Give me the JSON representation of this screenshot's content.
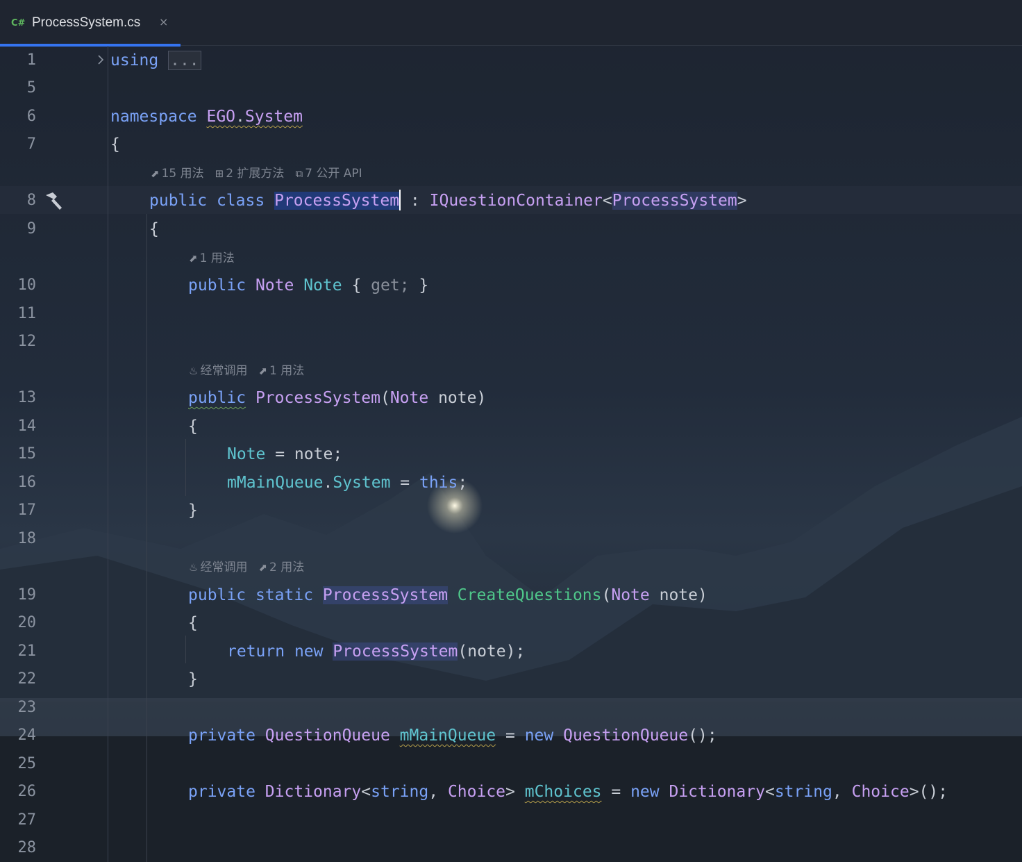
{
  "tab": {
    "lang_badge": "C#",
    "title": "ProcessSystem.cs",
    "close_glyph": "×"
  },
  "hints": {
    "class_usages": "15 用法",
    "class_extensions": "2 扩展方法",
    "class_public_api": "7 公开 API",
    "prop_usages": "1 用法",
    "ctor_frequent": "经常调用",
    "ctor_usages": "1 用法",
    "static_frequent": "经常调用",
    "static_usages": "2 用法"
  },
  "lines": [
    {
      "n": "1"
    },
    {
      "n": "5"
    },
    {
      "n": "6"
    },
    {
      "n": "7"
    },
    {
      "n": "8"
    },
    {
      "n": "9"
    },
    {
      "n": "10"
    },
    {
      "n": "11"
    },
    {
      "n": "12"
    },
    {
      "n": "13"
    },
    {
      "n": "14"
    },
    {
      "n": "15"
    },
    {
      "n": "16"
    },
    {
      "n": "17"
    },
    {
      "n": "18"
    },
    {
      "n": "19"
    },
    {
      "n": "20"
    },
    {
      "n": "21"
    },
    {
      "n": "22"
    },
    {
      "n": "23"
    },
    {
      "n": "24"
    },
    {
      "n": "25"
    },
    {
      "n": "26"
    },
    {
      "n": "27"
    },
    {
      "n": "28"
    }
  ],
  "code": {
    "l1_using": "using",
    "l1_fold": "...",
    "l6_namespace": "namespace",
    "l6_ns_name_1": "EGO",
    "l6_ns_dot": ".",
    "l6_ns_name_2": "System",
    "l7_brace": "{",
    "l8_public": "public",
    "l8_class": "class",
    "l8_name": "ProcessSystem",
    "l8_colon": " : ",
    "l8_iface": "IQuestionContainer",
    "l8_lt": "<",
    "l8_generic": "ProcessSystem",
    "l8_gt": ">",
    "l9_brace": "{",
    "l10_public": "public",
    "l10_type": "Note",
    "l10_prop": "Note",
    "l10_open": "{ ",
    "l10_get": "get;",
    "l10_close": " }",
    "l13_public": "public",
    "l13_ctor": "ProcessSystem",
    "l13_open": "(",
    "l13_ptype": "Note",
    "l13_pname": " note)",
    "l14_brace": "{",
    "l15_prop": "Note",
    "l15_rest": " = note;",
    "l16_field": "mMainQueue",
    "l16_dot": ".",
    "l16_prop": "System",
    "l16_eq": " = ",
    "l16_this": "this",
    "l16_semi": ";",
    "l17_brace": "}",
    "l19_public": "public",
    "l19_static": "static",
    "l19_rtype": "ProcessSystem",
    "l19_fn": "CreateQuestions",
    "l19_open": "(",
    "l19_ptype": "Note",
    "l19_pname": " note)",
    "l20_brace": "{",
    "l21_return": "return",
    "l21_new": "new",
    "l21_type": "ProcessSystem",
    "l21_rest": "(note);",
    "l22_brace": "}",
    "l24_private": "private",
    "l24_type": "QuestionQueue",
    "l24_field": "mMainQueue",
    "l24_eq": " = ",
    "l24_new": "new",
    "l24_ctor": "QuestionQueue",
    "l24_rest": "();",
    "l26_private": "private",
    "l26_type": "Dictionary",
    "l26_lt": "<",
    "l26_string": "string",
    "l26_comma": ", ",
    "l26_choice": "Choice",
    "l26_gt": "> ",
    "l26_field": "mChoices",
    "l26_eq": " = ",
    "l26_new": "new",
    "l26_type2": "Dictionary",
    "l26_lt2": "<",
    "l26_string2": "string",
    "l26_comma2": ", ",
    "l26_choice2": "Choice",
    "l26_rest": ">();"
  },
  "icons": {
    "tab_close": "close-icon",
    "fold": "chevron-right-icon",
    "build": "hammer-icon",
    "usages": "usages-icon",
    "extensions": "extensions-icon",
    "public_api": "public-api-icon",
    "frequent": "flame-icon"
  },
  "colors": {
    "keyword": "#7aa2f7",
    "type": "#c7a0f2",
    "property": "#5fc4cf",
    "method": "#4fc78a",
    "accent": "#3574f0"
  }
}
